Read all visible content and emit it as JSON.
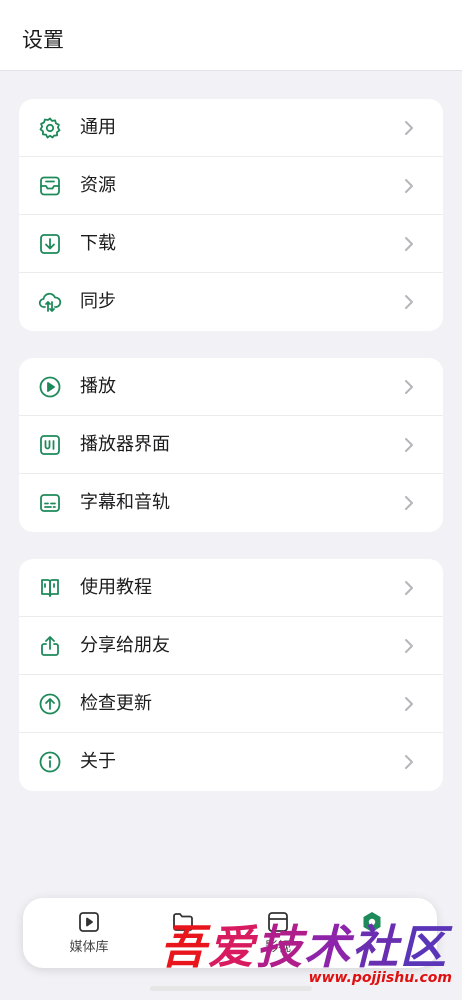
{
  "header": {
    "title": "设置"
  },
  "colors": {
    "accent": "#1e8a5a",
    "chevron": "#b5b5ba"
  },
  "groups": [
    {
      "items": [
        {
          "label": "通用",
          "icon": "gear-icon"
        },
        {
          "label": "资源",
          "icon": "inbox-icon"
        },
        {
          "label": "下载",
          "icon": "download-icon"
        },
        {
          "label": "同步",
          "icon": "cloud-sync-icon"
        }
      ]
    },
    {
      "items": [
        {
          "label": "播放",
          "icon": "play-circle-icon"
        },
        {
          "label": "播放器界面",
          "icon": "ui-box-icon"
        },
        {
          "label": "字幕和音轨",
          "icon": "subtitles-icon"
        }
      ]
    },
    {
      "items": [
        {
          "label": "使用教程",
          "icon": "book-icon"
        },
        {
          "label": "分享给朋友",
          "icon": "share-icon"
        },
        {
          "label": "检查更新",
          "icon": "arrow-up-circle-icon"
        },
        {
          "label": "关于",
          "icon": "info-icon"
        }
      ]
    }
  ],
  "tabbar": {
    "tabs": [
      {
        "label": "媒体库",
        "icon": "media-library-icon"
      },
      {
        "label": "",
        "icon": "folder-icon"
      },
      {
        "label": "影视",
        "icon": "video-icon"
      },
      {
        "label": "",
        "icon": "settings-hex-icon"
      }
    ]
  },
  "watermark": {
    "chars": [
      "吾",
      "爱",
      "技",
      "术",
      "社",
      "区"
    ],
    "url": "www.pojjishu.com"
  }
}
